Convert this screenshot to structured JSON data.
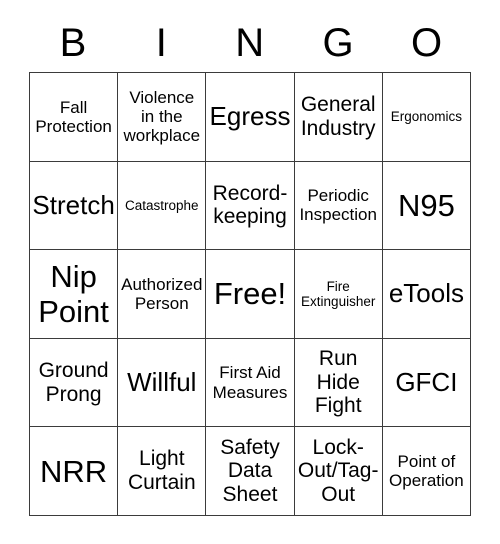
{
  "card": {
    "headers": [
      "B",
      "I",
      "N",
      "G",
      "O"
    ],
    "rows": [
      [
        {
          "text": "Fall\nProtection",
          "size": "sm"
        },
        {
          "text": "Violence\nin the\nworkplace",
          "size": "sm"
        },
        {
          "text": "Egress",
          "size": "lg"
        },
        {
          "text": "General\nIndustry",
          "size": "md"
        },
        {
          "text": "Ergonomics",
          "size": "xs"
        }
      ],
      [
        {
          "text": "Stretch",
          "size": "lg"
        },
        {
          "text": "Catastrophe",
          "size": "xs"
        },
        {
          "text": "Record-\nkeeping",
          "size": "md"
        },
        {
          "text": "Periodic\nInspection",
          "size": "sm"
        },
        {
          "text": "N95",
          "size": "xl"
        }
      ],
      [
        {
          "text": "Nip\nPoint",
          "size": "xl"
        },
        {
          "text": "Authorized\nPerson",
          "size": "sm"
        },
        {
          "text": "Free!",
          "size": "xl"
        },
        {
          "text": "Fire\nExtinguisher",
          "size": "xs"
        },
        {
          "text": "eTools",
          "size": "lg"
        }
      ],
      [
        {
          "text": "Ground\nProng",
          "size": "md"
        },
        {
          "text": "Willful",
          "size": "lg"
        },
        {
          "text": "First Aid\nMeasures",
          "size": "sm"
        },
        {
          "text": "Run\nHide\nFight",
          "size": "md"
        },
        {
          "text": "GFCI",
          "size": "lg"
        }
      ],
      [
        {
          "text": "NRR",
          "size": "xl"
        },
        {
          "text": "Light\nCurtain",
          "size": "md"
        },
        {
          "text": "Safety\nData\nSheet",
          "size": "md"
        },
        {
          "text": "Lock-\nOut/Tag-\nOut",
          "size": "md"
        },
        {
          "text": "Point of\nOperation",
          "size": "sm"
        }
      ]
    ]
  }
}
